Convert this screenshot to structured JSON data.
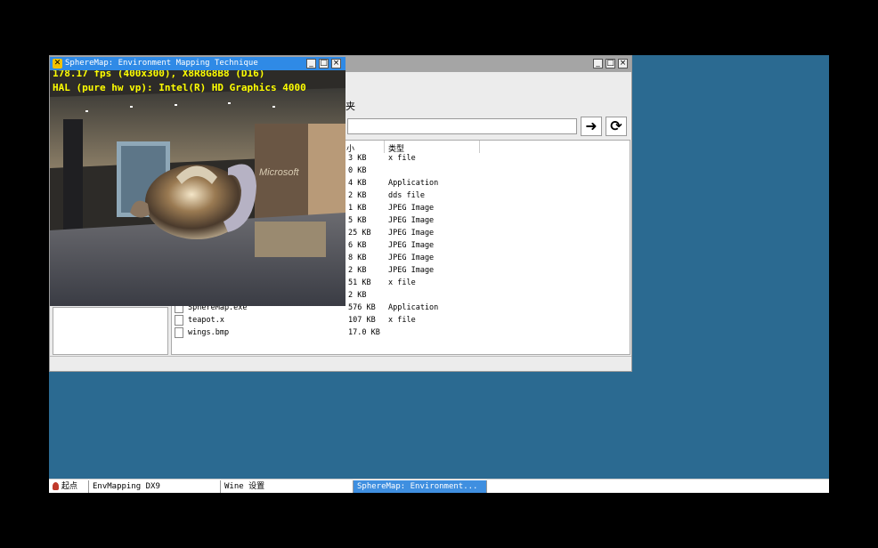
{
  "sphere_window": {
    "title": "SphereMap: Environment Mapping Technique",
    "stats_line1": "178.17 fps (400x300), X8R8G8B8 (D16)",
    "stats_line2": "HAL (pure hw vp): Intel(R) HD Graphics 4000",
    "sign_text": "Microsoft"
  },
  "explorer": {
    "menu_partial": "夹",
    "columns": {
      "size": "小",
      "type": "类型"
    },
    "nav": {
      "go_glyph": "➜",
      "refresh_glyph": "⟳"
    },
    "files": [
      {
        "name": "",
        "size": "3 KB",
        "type": "x file"
      },
      {
        "name": "",
        "size": "0 KB",
        "type": ""
      },
      {
        "name": "",
        "size": "4 KB",
        "type": "Application"
      },
      {
        "name": "",
        "size": "2 KB",
        "type": "dds file"
      },
      {
        "name": "",
        "size": "1 KB",
        "type": "JPEG Image"
      },
      {
        "name": "",
        "size": "5 KB",
        "type": "JPEG Image"
      },
      {
        "name": "",
        "size": "25 KB",
        "type": "JPEG Image"
      },
      {
        "name": "",
        "size": "6 KB",
        "type": "JPEG Image"
      },
      {
        "name": "",
        "size": "8 KB",
        "type": "JPEG Image"
      },
      {
        "name": "",
        "size": "2 KB",
        "type": "JPEG Image"
      },
      {
        "name": "",
        "size": "51 KB",
        "type": "x file"
      },
      {
        "name": "",
        "size": "2 KB",
        "type": ""
      },
      {
        "name": "SphereMap.exe",
        "size": "576 KB",
        "type": "Application"
      },
      {
        "name": "teapot.x",
        "size": "107 KB",
        "type": "x file"
      },
      {
        "name": "wings.bmp",
        "size": "17.0 KB",
        "type": ""
      }
    ]
  },
  "taskbar": {
    "start_label": "起点",
    "tasks": [
      {
        "label": "EnvMapping DX9",
        "active": false
      },
      {
        "label": "Wine 设置",
        "active": false
      },
      {
        "label": "SphereMap: Environment...",
        "active": true
      }
    ]
  },
  "colors": {
    "desktop": "#2b6a91",
    "title_active": "#2f8ae6",
    "stats_text": "#ffff00",
    "task_active": "#3f8fe0"
  },
  "icons": {
    "app": "dx-app-icon",
    "minimize": "minimize-icon",
    "maximize": "maximize-icon",
    "close": "close-icon",
    "go": "arrow-right-icon",
    "refresh": "refresh-icon",
    "file": "file-icon",
    "start": "wine-glass-icon"
  }
}
